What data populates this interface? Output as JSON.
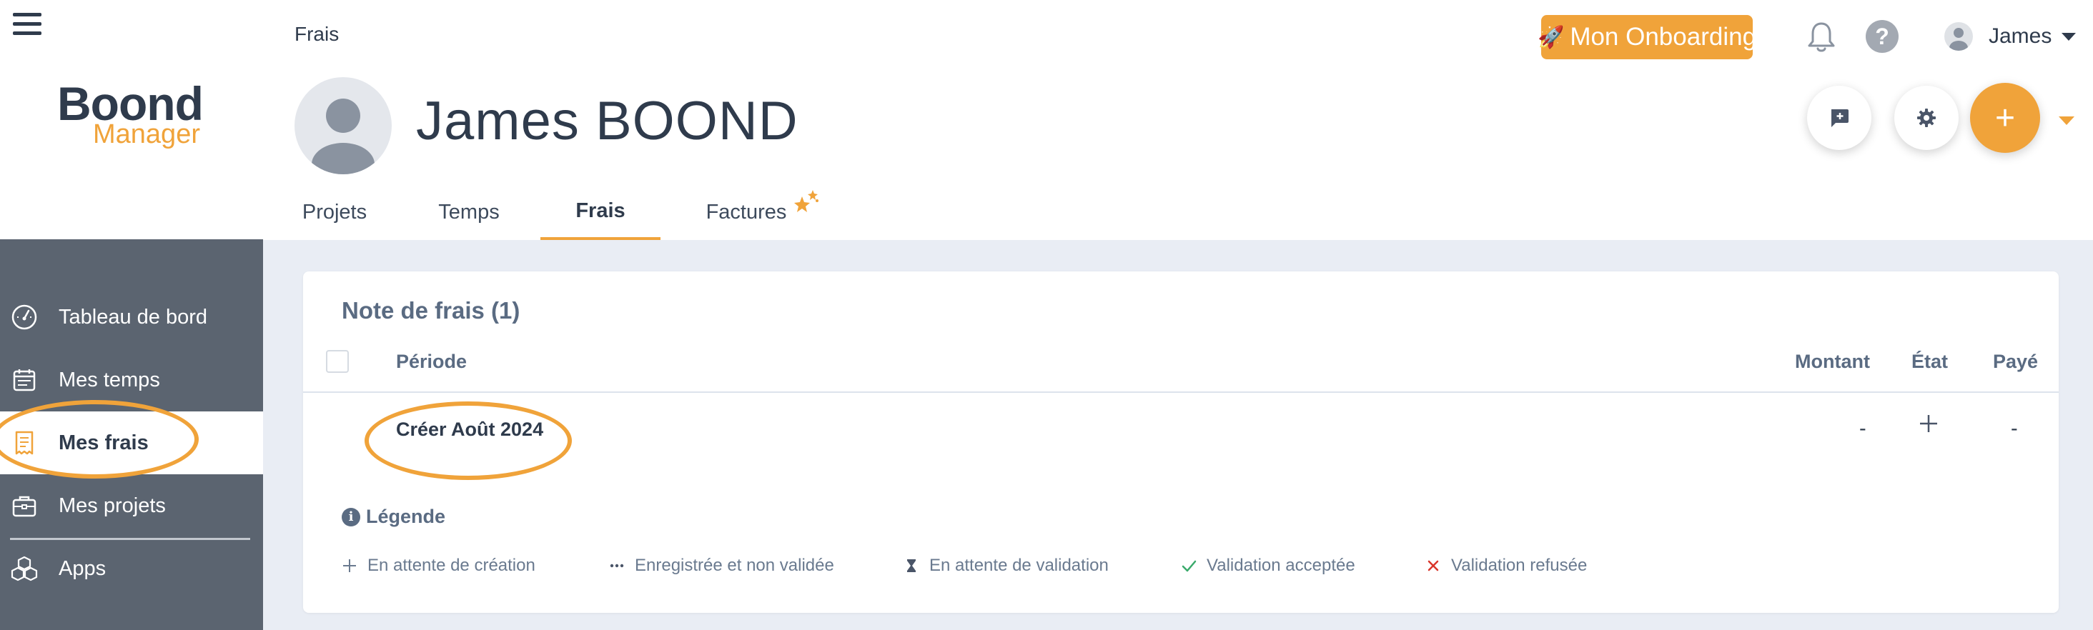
{
  "sidebar": {
    "logo_main": "Boond",
    "logo_sub": "Manager",
    "items": [
      {
        "label": "Tableau de bord",
        "icon": "gauge-icon"
      },
      {
        "label": "Mes temps",
        "icon": "calendar-icon"
      },
      {
        "label": "Mes frais",
        "icon": "receipt-icon",
        "active": true
      },
      {
        "label": "Mes projets",
        "icon": "briefcase-icon"
      },
      {
        "label": "Apps",
        "icon": "cubes-icon"
      }
    ]
  },
  "header": {
    "breadcrumb": "Frais",
    "onboarding_label": "Mon Onboarding",
    "help_label": "?",
    "user_name": "James",
    "profile_name": "James BOOND",
    "add_label": "+"
  },
  "tabs": [
    {
      "label": "Projets"
    },
    {
      "label": "Temps"
    },
    {
      "label": "Frais",
      "active": true
    },
    {
      "label": "Factures",
      "badge": "stars-icon"
    }
  ],
  "card": {
    "title": "Note de frais (1)",
    "columns": {
      "periode": "Période",
      "montant": "Montant",
      "etat": "État",
      "paye": "Payé"
    },
    "rows": [
      {
        "periode": "Créer Août 2024",
        "montant": "-",
        "etat": "+",
        "paye": "-"
      }
    ],
    "legend_title": "Légende",
    "legend": [
      {
        "label": "En attente de création",
        "icon": "plus-icon"
      },
      {
        "label": "Enregistrée et non validée",
        "icon": "ellipsis-icon"
      },
      {
        "label": "En attente de validation",
        "icon": "hourglass-icon"
      },
      {
        "label": "Validation acceptée",
        "icon": "check-icon"
      },
      {
        "label": "Validation refusée",
        "icon": "cross-icon"
      }
    ]
  },
  "colors": {
    "accent": "#f0a33a",
    "sidebar_bg": "#5b6470",
    "text_dark": "#2f3b4c",
    "text_muted": "#5a6b82",
    "check_green": "#3aaa6b",
    "cross_red": "#d9362b"
  }
}
